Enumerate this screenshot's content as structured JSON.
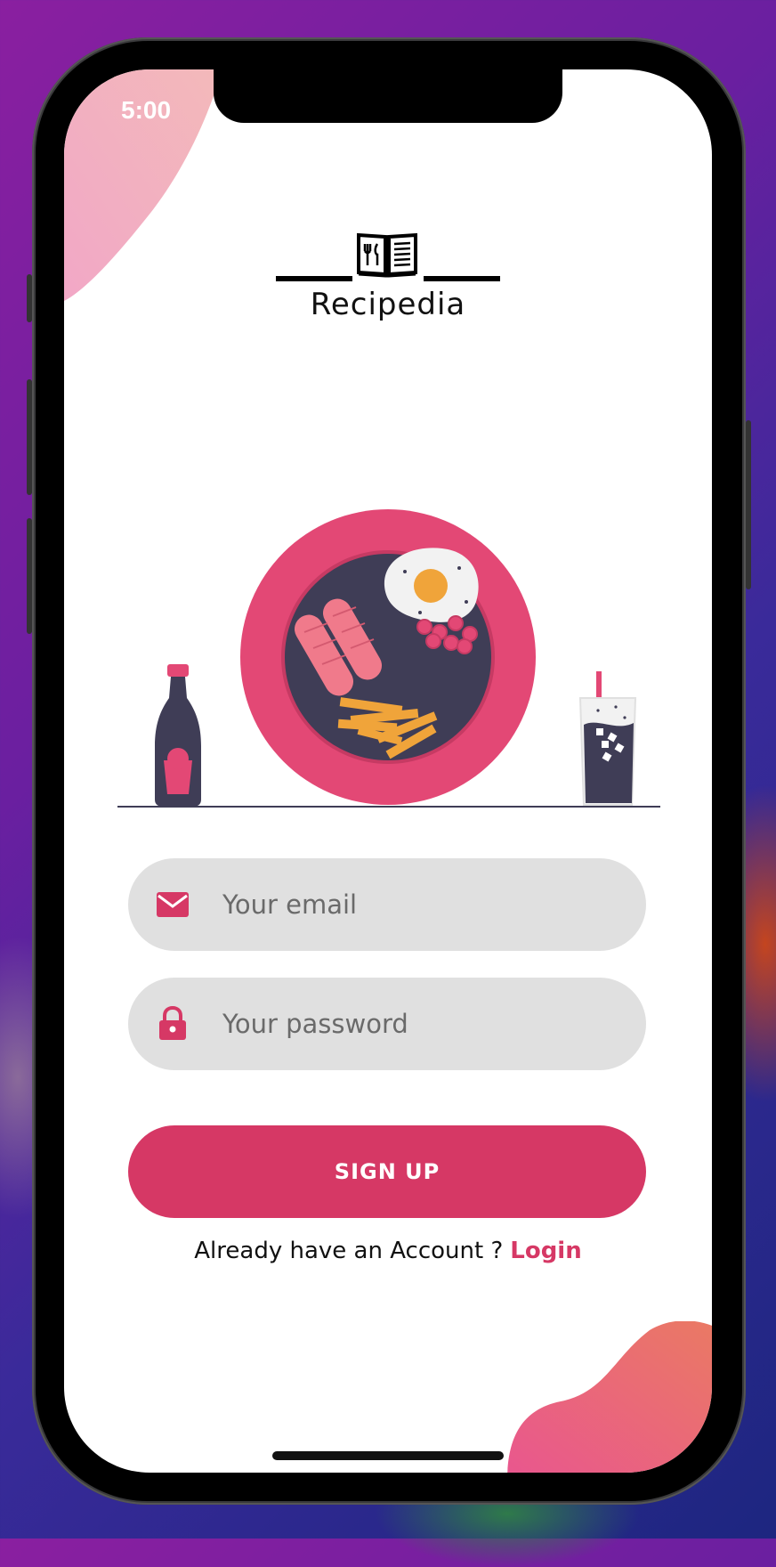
{
  "status_bar": {
    "time": "5:00"
  },
  "brand": {
    "name": "Recipedia"
  },
  "form": {
    "email_placeholder": "Your email",
    "password_placeholder": "Your password",
    "signup_label": "SIGN UP"
  },
  "footer": {
    "prompt": "Already have an Account ?",
    "login_label": "Login"
  },
  "colors": {
    "accent": "#d63865",
    "field_bg": "#e0e0e0",
    "plate": "#e34875",
    "dark": "#3f3d56"
  },
  "icons": {
    "email": "mail-icon",
    "password": "lock-icon",
    "logo": "recipe-book-icon"
  }
}
